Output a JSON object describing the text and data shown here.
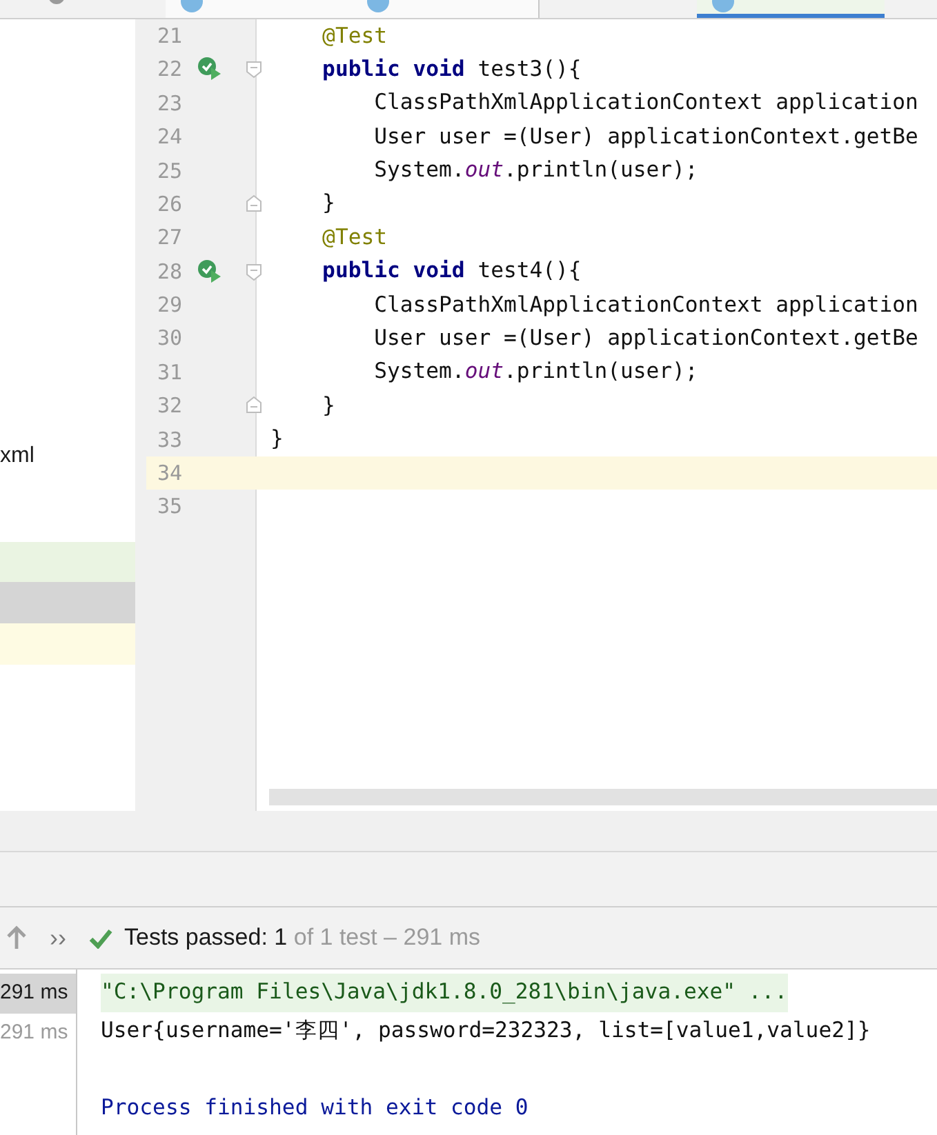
{
  "editor_tabs": [
    {
      "selected": false
    },
    {
      "selected": false
    },
    {
      "selected": true
    }
  ],
  "project_panel": {
    "items": [
      {
        "label": "xml",
        "kind": "text"
      },
      {
        "kind": "added"
      },
      {
        "kind": "selected"
      },
      {
        "kind": "modified"
      }
    ]
  },
  "code": {
    "lines": [
      {
        "number": "21",
        "kind": "plain",
        "run_icon": false,
        "current": false,
        "segments": [
          {
            "text": "    @Test",
            "kind": "annotation"
          }
        ]
      },
      {
        "number": "22",
        "kind": "fold_start",
        "run_icon": true,
        "current": false,
        "segments": [
          {
            "text": "    public void",
            "kind": "keyword"
          },
          {
            "text": " test3(){"
          }
        ]
      },
      {
        "number": "23",
        "kind": "plain",
        "run_icon": false,
        "current": false,
        "segments": [
          {
            "text": "        ClassPathXmlApplicationContext application"
          }
        ]
      },
      {
        "number": "24",
        "kind": "plain",
        "run_icon": false,
        "current": false,
        "segments": [
          {
            "text": "        User user =(User) applicationContext.getBe"
          }
        ]
      },
      {
        "number": "25",
        "kind": "plain",
        "run_icon": false,
        "current": false,
        "segments": [
          {
            "text": "        System."
          },
          {
            "text": "out",
            "kind": "static"
          },
          {
            "text": ".println(user);"
          }
        ]
      },
      {
        "number": "26",
        "kind": "fold_end",
        "run_icon": false,
        "current": false,
        "segments": [
          {
            "text": "    }"
          }
        ]
      },
      {
        "number": "27",
        "kind": "plain",
        "run_icon": false,
        "current": false,
        "segments": [
          {
            "text": "    @Test",
            "kind": "annotation"
          }
        ]
      },
      {
        "number": "28",
        "kind": "fold_start",
        "run_icon": true,
        "current": false,
        "segments": [
          {
            "text": "    public void",
            "kind": "keyword"
          },
          {
            "text": " test4(){"
          }
        ]
      },
      {
        "number": "29",
        "kind": "plain",
        "run_icon": false,
        "current": false,
        "segments": [
          {
            "text": "        ClassPathXmlApplicationContext application"
          }
        ]
      },
      {
        "number": "30",
        "kind": "plain",
        "run_icon": false,
        "current": false,
        "segments": [
          {
            "text": "        User user =(User) applicationContext.getBe"
          }
        ]
      },
      {
        "number": "31",
        "kind": "plain",
        "run_icon": false,
        "current": false,
        "segments": [
          {
            "text": "        System."
          },
          {
            "text": "out",
            "kind": "static"
          },
          {
            "text": ".println(user);"
          }
        ]
      },
      {
        "number": "32",
        "kind": "fold_end",
        "run_icon": false,
        "current": false,
        "segments": [
          {
            "text": "    }"
          }
        ]
      },
      {
        "number": "33",
        "kind": "plain",
        "run_icon": false,
        "current": false,
        "segments": [
          {
            "text": "}"
          }
        ]
      },
      {
        "number": "34",
        "kind": "plain",
        "run_icon": false,
        "current": true
      },
      {
        "number": "35",
        "kind": "plain",
        "run_icon": false,
        "current": false
      }
    ]
  },
  "run_toolbar": {
    "more": "››",
    "status": "Tests passed: 1",
    "detail": "of 1 test – 291 ms"
  },
  "test_tree": [
    {
      "label": "291 ms",
      "selected": true
    },
    {
      "label": "291 ms",
      "selected": false
    }
  ],
  "console": [
    {
      "kind": "command",
      "text": "\"C:\\Program Files\\Java\\jdk1.8.0_281\\bin\\java.exe\" ..."
    },
    {
      "kind": "output",
      "text": "User{username='李四', password=232323, list=[value1,value2]}"
    },
    {
      "kind": "blank"
    },
    {
      "kind": "exit",
      "text": "Process finished with exit code 0"
    }
  ]
}
